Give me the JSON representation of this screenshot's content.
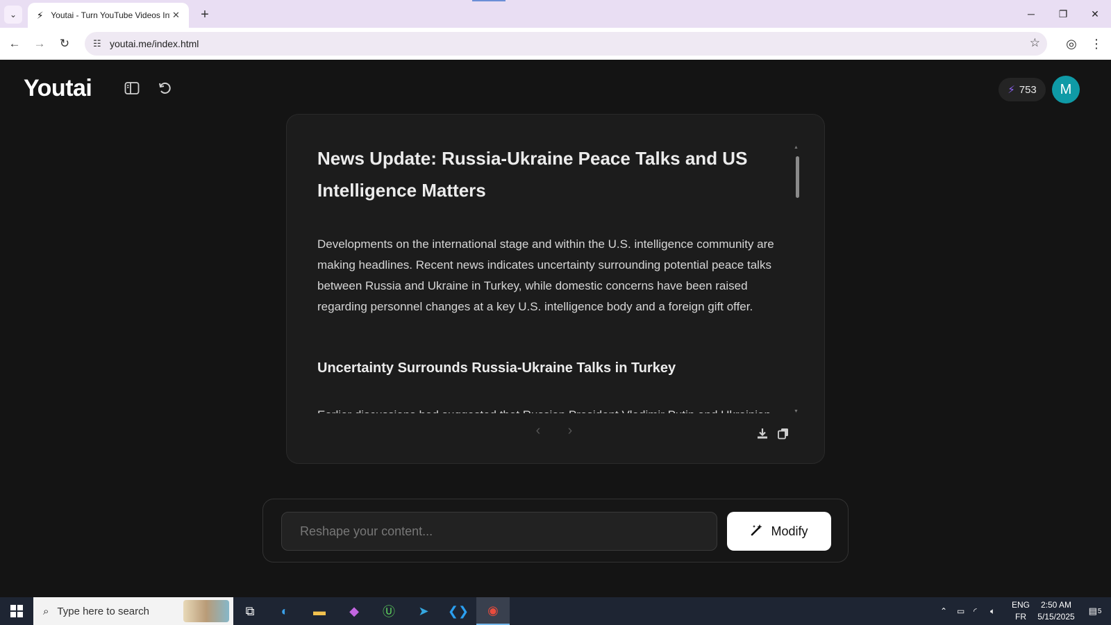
{
  "browser": {
    "tab_title": "Youtai - Turn YouTube Videos Into",
    "url": "youtai.me/index.html"
  },
  "icons": {
    "tab_menu": "chevron-down-icon",
    "favicon": "bolt-icon",
    "tab_close": "close-icon",
    "new_tab": "plus-icon",
    "back": "arrow-left-icon",
    "forward": "arrow-right-icon",
    "reload": "reload-icon",
    "site_info": "tune-icon",
    "bookmark": "star-icon",
    "profile": "user-circle-icon",
    "menu": "kebab-menu-icon"
  },
  "app": {
    "logo": "Youtai",
    "credits": "753",
    "avatar_initial": "M",
    "accent_color": "#8e63f5",
    "avatar_color": "#0f9aa6"
  },
  "article": {
    "title": "News Update: Russia-Ukraine Peace Talks and US Intelligence Matters",
    "intro": "Developments on the international stage and within the U.S. intelligence community are making headlines. Recent news indicates uncertainty surrounding potential peace talks between Russia and Ukraine in Turkey, while domestic concerns have been raised regarding personnel changes at a key U.S. intelligence body and a foreign gift offer.",
    "section_heading": "Uncertainty Surrounds Russia-Ukraine Talks in Turkey",
    "section_text": "Earlier discussions had suggested that Russian President Vladimir Putin and Ukrainian"
  },
  "prompt": {
    "placeholder": "Reshape your content...",
    "button_label": "Modify"
  },
  "taskbar": {
    "search_placeholder": "Type here to search",
    "lang_top": "ENG",
    "lang_bottom": "FR",
    "time": "2:50 AM",
    "date": "5/15/2025",
    "notifications": "5"
  }
}
